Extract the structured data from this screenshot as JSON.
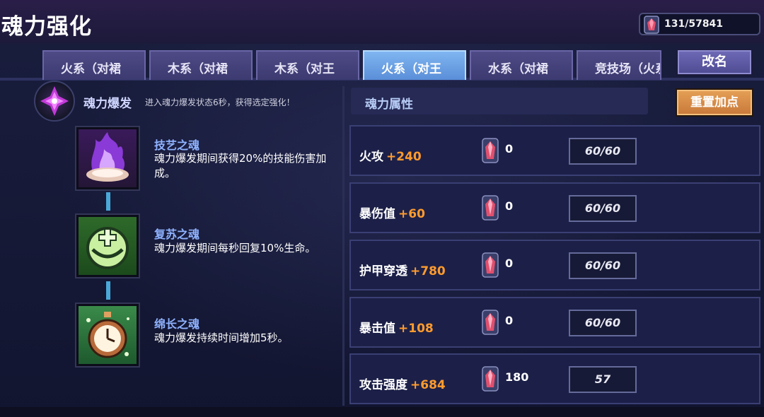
{
  "header": {
    "title": "魂力强化",
    "currency_value": "131/57841",
    "currency_icon": "soul-crystal-icon"
  },
  "tabs": [
    {
      "label": "火系（对裙",
      "active": false
    },
    {
      "label": "木系（对裙",
      "active": false
    },
    {
      "label": "木系（对王",
      "active": false
    },
    {
      "label": "火系（对王",
      "active": true
    },
    {
      "label": "水系（对裙",
      "active": false
    },
    {
      "label": "竞技场（火系",
      "active": false
    }
  ],
  "rename_button": "改名",
  "burst": {
    "title": "魂力爆发",
    "description": "进入魂力爆发状态6秒，获得选定强化！"
  },
  "skills": [
    {
      "name": "技艺之魂",
      "description": "魂力爆发期间获得20%的技能伤害加成。",
      "icon": "purple-flame-icon"
    },
    {
      "name": "复苏之魂",
      "description": "魂力爆发期间每秒回复10%生命。",
      "icon": "green-heal-icon"
    },
    {
      "name": "绵长之魂",
      "description": "魂力爆发持续时间增加5秒。",
      "icon": "stopwatch-icon"
    }
  ],
  "attributes_header": "魂力属性",
  "reset_button": "重置加点",
  "attributes": [
    {
      "name": "火攻",
      "bonus": "+240",
      "cost": "0",
      "level": "60/60"
    },
    {
      "name": "暴伤值",
      "bonus": "+60",
      "cost": "0",
      "level": "60/60"
    },
    {
      "name": "护甲穿透",
      "bonus": "+780",
      "cost": "0",
      "level": "60/60"
    },
    {
      "name": "暴击值",
      "bonus": "+108",
      "cost": "0",
      "level": "60/60"
    },
    {
      "name": "攻击强度",
      "bonus": "+684",
      "cost": "180",
      "level": "57"
    }
  ],
  "colors": {
    "accent_orange": "#ff9b2e",
    "active_tab": "#6aa2e4",
    "skill_name": "#8fb3ff"
  }
}
